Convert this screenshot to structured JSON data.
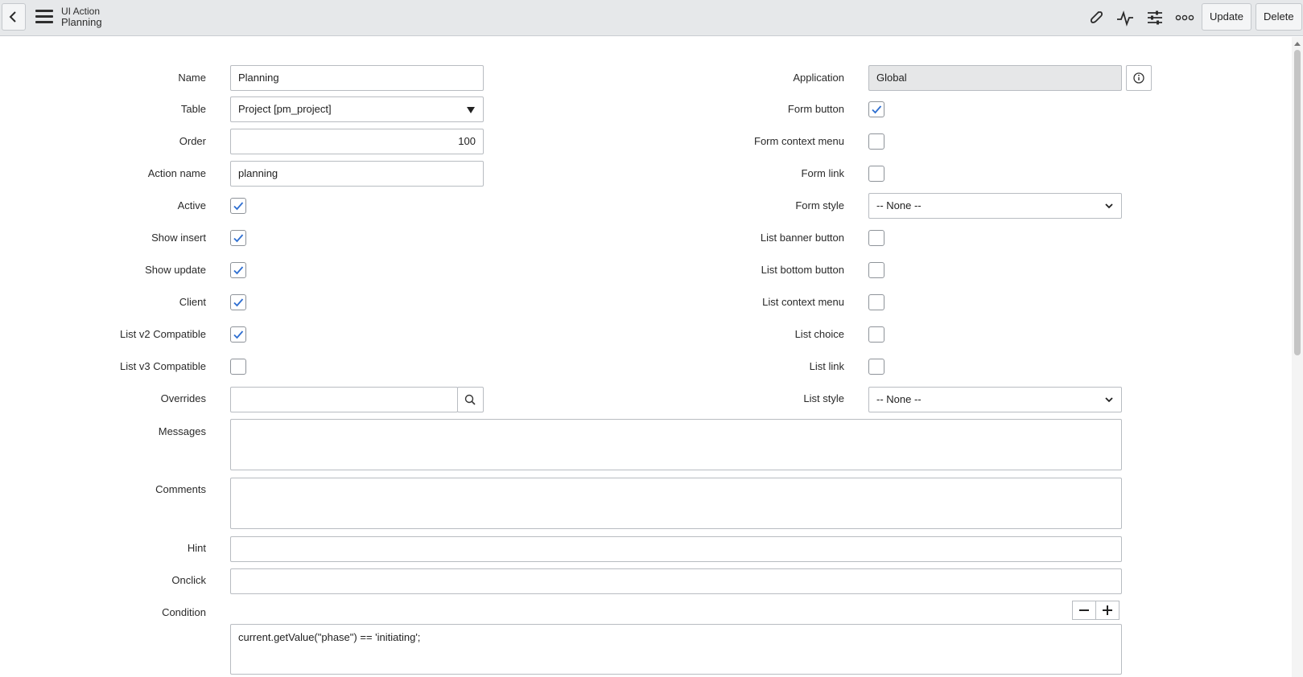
{
  "header": {
    "record_type": "UI Action",
    "record_name": "Planning",
    "icons": [
      "back-icon",
      "menu-icon",
      "paperclip-icon",
      "activity-icon",
      "settings-sliders-icon",
      "more-icon"
    ],
    "buttons": {
      "update": "Update",
      "delete": "Delete"
    }
  },
  "form": {
    "left": {
      "name": {
        "label": "Name",
        "value": "Planning"
      },
      "table": {
        "label": "Table",
        "value": "Project [pm_project]"
      },
      "order": {
        "label": "Order",
        "value": "100"
      },
      "action_name": {
        "label": "Action name",
        "value": "planning"
      },
      "active": {
        "label": "Active",
        "checked": true
      },
      "show_insert": {
        "label": "Show insert",
        "checked": true
      },
      "show_update": {
        "label": "Show update",
        "checked": true
      },
      "client": {
        "label": "Client",
        "checked": true
      },
      "list_v2": {
        "label": "List v2 Compatible",
        "checked": true
      },
      "list_v3": {
        "label": "List v3 Compatible",
        "checked": false
      },
      "overrides": {
        "label": "Overrides",
        "value": ""
      }
    },
    "right": {
      "application": {
        "label": "Application",
        "value": "Global"
      },
      "form_button": {
        "label": "Form button",
        "checked": true
      },
      "form_context_menu": {
        "label": "Form context menu",
        "checked": false
      },
      "form_link": {
        "label": "Form link",
        "checked": false
      },
      "form_style": {
        "label": "Form style",
        "value": "-- None --"
      },
      "list_banner_button": {
        "label": "List banner button",
        "checked": false
      },
      "list_bottom_button": {
        "label": "List bottom button",
        "checked": false
      },
      "list_context_menu": {
        "label": "List context menu",
        "checked": false
      },
      "list_choice": {
        "label": "List choice",
        "checked": false
      },
      "list_link": {
        "label": "List link",
        "checked": false
      },
      "list_style": {
        "label": "List style",
        "value": "-- None --"
      }
    },
    "full": {
      "messages": {
        "label": "Messages",
        "value": ""
      },
      "comments": {
        "label": "Comments",
        "value": ""
      },
      "hint": {
        "label": "Hint",
        "value": ""
      },
      "onclick": {
        "label": "Onclick",
        "value": ""
      },
      "condition": {
        "label": "Condition",
        "value": "current.getValue(\"phase\") == 'initiating';"
      }
    }
  },
  "colors": {
    "accent": "#2f6fd1",
    "header_bg": "#e6e8ea",
    "readonly_bg": "#e6e7e8"
  }
}
